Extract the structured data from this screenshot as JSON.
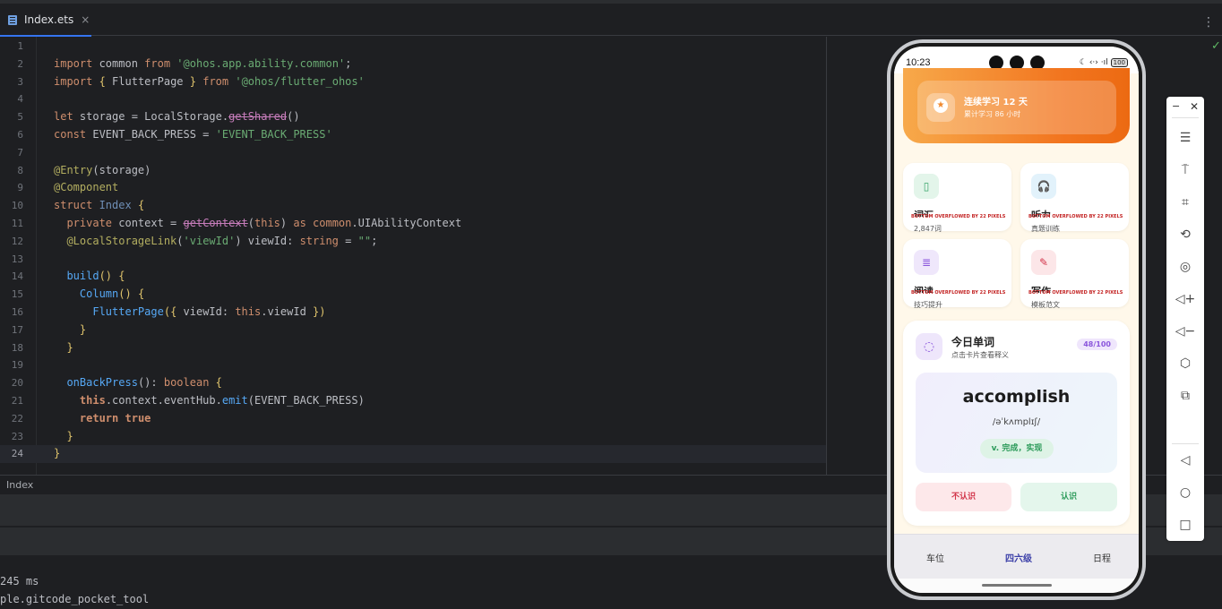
{
  "tab": {
    "label": "Index.ets",
    "close": "×"
  },
  "more_menu": "⋮",
  "inspection_ok": "✓",
  "code": {
    "ln": [
      "1",
      "2",
      "3",
      "4",
      "5",
      "6",
      "7",
      "8",
      "9",
      "10",
      "11",
      "12",
      "13",
      "14",
      "15",
      "16",
      "17",
      "18",
      "19",
      "20",
      "21",
      "22",
      "23",
      "24"
    ],
    "l2": {
      "import": "import",
      "name": " common ",
      "from": "from",
      "path": "'@ohos.app.ability.common'",
      "end": ";"
    },
    "l3": {
      "import": "import",
      "open": " { ",
      "name": "FlutterPage",
      "close": " } ",
      "from": "from",
      "path": "'@ohos/flutter_ohos'"
    },
    "l5": {
      "let": "let",
      "rest": " storage = LocalStorage.",
      "method": "getShared",
      "end": "()"
    },
    "l6": {
      "const": "const",
      "rest": " EVENT_BACK_PRESS = ",
      "value": "'EVENT_BACK_PRESS'"
    },
    "l8": {
      "dec": "@Entry",
      "args": "(storage)"
    },
    "l9": {
      "dec": "@Component"
    },
    "l10": {
      "struct": "struct",
      "name": " Index",
      "brace": " {"
    },
    "l11": {
      "private": "private",
      "rest": " context = ",
      "fn": "getContext",
      "open": "(",
      "this": "this",
      "close": ") ",
      "as": "as",
      "type": " common",
      "type2": ".UIAbilityContext"
    },
    "l12": {
      "dec": "@LocalStorageLink",
      "open": "(",
      "key": "'viewId'",
      "rest": ") viewId: ",
      "type": "string",
      "eq": " = ",
      "val": "\"\"",
      "end": ";"
    },
    "l14": {
      "fn": "build",
      "rest": "() {"
    },
    "l15": {
      "fn": "Column",
      "rest": "() {"
    },
    "l16": {
      "fn": "FlutterPage",
      "open": "({ ",
      "rest": "viewId: ",
      "this": "this",
      "prop": ".viewId",
      "close": " })"
    },
    "l17": {
      "brace": "}"
    },
    "l18": {
      "brace": "}"
    },
    "l20": {
      "fn": "onBackPress",
      "rest": "(): ",
      "type": "boolean",
      "brace": " {"
    },
    "l21": {
      "this": "this",
      "rest": ".context.eventHub.",
      "fn": "emit",
      "args": "(EVENT_BACK_PRESS)"
    },
    "l22": {
      "ret": "return",
      "val": " true"
    },
    "l23": {
      "brace": "}"
    },
    "l24": {
      "brace": "}"
    }
  },
  "breadcrumb": "Index",
  "console": [
    "245 ms",
    "ple.gitcode_pocket_tool"
  ],
  "phone": {
    "status": {
      "time": "10:23",
      "icons": "☾ ‹·› ·ıl",
      "battery": "100"
    },
    "streak": {
      "title": "连续学习 12 天",
      "subtitle": "累计学习 86 小时"
    },
    "tiles": [
      {
        "icon": "▯",
        "title": "词汇",
        "overflow": "BOTTOM OVERFLOWED BY 22 PIXELS",
        "sub": "2,847词",
        "icon_color": "#3aa56b",
        "icon_bg": "#e3f5ea"
      },
      {
        "icon": "🎧",
        "title": "听力",
        "overflow": "BOTTOM OVERFLOWED BY 22 PIXELS",
        "sub": "真题训练",
        "icon_color": "#2f97d4",
        "icon_bg": "#e2f2fb"
      },
      {
        "icon": "≣",
        "title": "阅读",
        "overflow": "BOTTOM OVERFLOWED BY 22 PIXELS",
        "sub": "技巧提升",
        "icon_color": "#8a55dc",
        "icon_bg": "#efe7fb"
      },
      {
        "icon": "✎",
        "title": "写作",
        "overflow": "BOTTOM OVERFLOWED BY 22 PIXELS",
        "sub": "模板范文",
        "icon_color": "#d2354a",
        "icon_bg": "#fce6e8"
      }
    ],
    "word_card": {
      "title": "今日单词",
      "subtitle": "点击卡片查看释义",
      "badge": "48/100",
      "word": "accomplish",
      "phonetic": "/əˈkʌmplɪʃ/",
      "meaning": "v. 完成，实现",
      "btn_unknown": "不认识",
      "btn_known": "认识"
    },
    "nav": [
      "车位",
      "四六级",
      "日程"
    ],
    "nav_active": 1
  },
  "emulator_toolbar": {
    "minimize": "−",
    "close": "✕",
    "buttons": [
      "☰",
      "⍑",
      "⌗",
      "⟲",
      "◎",
      "◁+",
      "◁−",
      "⬡",
      "⧉"
    ],
    "nav_buttons": [
      "◁",
      "○",
      "□"
    ]
  },
  "colors": {
    "accent": "#3574f0",
    "orange": "#f2751f",
    "purple": "#8a55dc",
    "green": "#2b9a59",
    "red": "#d2354a"
  }
}
